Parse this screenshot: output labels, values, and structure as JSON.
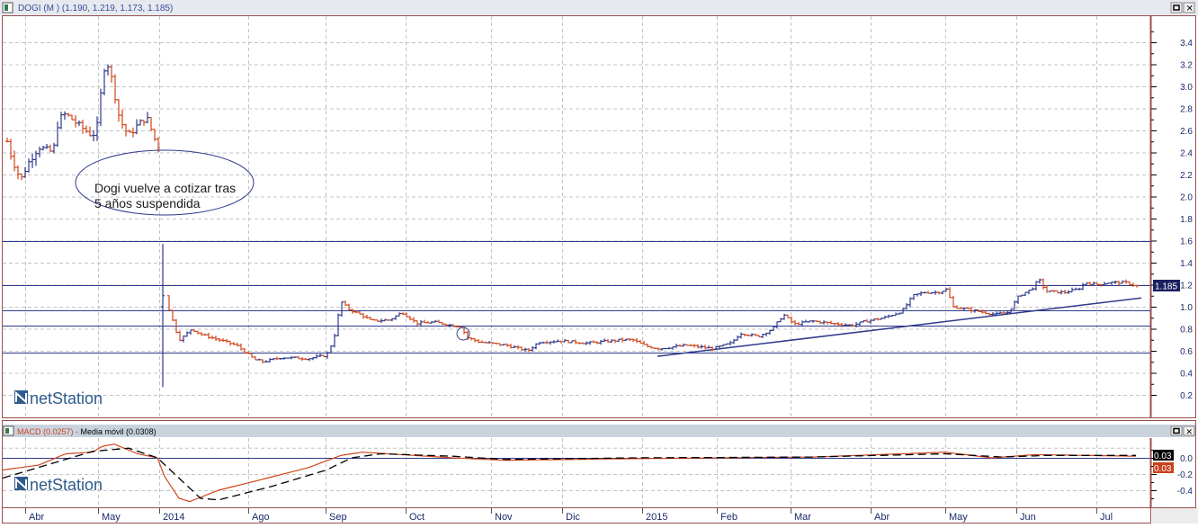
{
  "window": {
    "title": "DOGI (M ) (1.190, 1.219, 1.173, 1.185)",
    "minimize_icon": "restore-icon",
    "close_icon": "close-icon"
  },
  "annotation": {
    "line1": "Dogi vuelve a cotizar tras",
    "line2": "5 años suspendida"
  },
  "logo": "netStation",
  "price_tag": "1.185",
  "macd_panel": {
    "title_macd": "MACD (0.0257)",
    "title_sep": " - ",
    "title_signal": "Media móvil (0.0308)",
    "tag_signal": "0.03",
    "tag_macd": "0.03"
  },
  "colors": {
    "up": "#2e3a8c",
    "down": "#d0461c",
    "hline": "#2e3a8c",
    "frame": "#9b4f4f",
    "tag_bg": "#1a2060"
  },
  "chart_data": [
    {
      "type": "ohlc",
      "title": "DOGI (M )",
      "ylim": [
        0.1,
        3.5
      ],
      "yticks": [
        "0.2",
        "0.4",
        "0.6",
        "0.8",
        "1.0",
        "1.2",
        "1.4",
        "1.6",
        "1.8",
        "2.0",
        "2.2",
        "2.4",
        "2.6",
        "2.8",
        "3.0",
        "3.2",
        "3.4"
      ],
      "xticks": [
        "Abr",
        "May",
        "2014",
        "Ago",
        "Sep",
        "Oct",
        "Nov",
        "Dic",
        "2015",
        "Feb",
        "Mar",
        "Abr",
        "May",
        "Jun",
        "Jul"
      ],
      "x_range_bars": [
        0,
        320
      ],
      "gap_after_bar": 43.5,
      "spike_bar": {
        "x": 44.5,
        "low": 0.27,
        "high": 1.57,
        "close": 1.1
      },
      "close_path": [
        [
          1.25,
          2.5
        ],
        [
          2.5,
          2.35
        ],
        [
          5,
          2.15
        ],
        [
          7,
          2.3
        ],
        [
          10,
          2.45
        ],
        [
          14,
          2.4
        ],
        [
          15.5,
          2.7
        ],
        [
          17.5,
          2.75
        ],
        [
          21,
          2.65
        ],
        [
          25,
          2.55
        ],
        [
          27,
          2.7
        ],
        [
          27.5,
          3.15
        ],
        [
          29.5,
          3.2
        ],
        [
          31,
          2.95
        ],
        [
          32.5,
          2.7
        ],
        [
          35,
          2.55
        ],
        [
          37.5,
          2.65
        ],
        [
          40,
          2.72
        ],
        [
          42.5,
          2.5
        ],
        [
          43.5,
          2.45
        ],
        [
          45.5,
          1.02
        ],
        [
          46,
          1.0
        ],
        [
          49,
          0.7
        ],
        [
          50,
          0.72
        ],
        [
          52.5,
          0.8
        ],
        [
          55,
          0.75
        ],
        [
          60,
          0.7
        ],
        [
          65,
          0.65
        ],
        [
          70,
          0.52
        ],
        [
          72.5,
          0.5
        ],
        [
          77.5,
          0.54
        ],
        [
          85,
          0.53
        ],
        [
          90,
          0.56
        ],
        [
          92,
          0.7
        ],
        [
          94,
          1.05
        ],
        [
          96,
          0.98
        ],
        [
          100,
          0.92
        ],
        [
          102.5,
          0.87
        ],
        [
          107.5,
          0.88
        ],
        [
          111,
          0.95
        ],
        [
          115,
          0.85
        ],
        [
          120,
          0.86
        ],
        [
          125,
          0.83
        ],
        [
          127.5,
          0.82
        ],
        [
          129,
          0.72
        ],
        [
          132.5,
          0.68
        ],
        [
          140,
          0.65
        ],
        [
          146,
          0.6
        ],
        [
          149,
          0.68
        ],
        [
          155,
          0.69
        ],
        [
          162.5,
          0.67
        ],
        [
          172.5,
          0.7
        ],
        [
          175,
          0.7
        ],
        [
          179,
          0.64
        ],
        [
          182.5,
          0.62
        ],
        [
          190,
          0.65
        ],
        [
          197.5,
          0.62
        ],
        [
          202.5,
          0.67
        ],
        [
          205,
          0.76
        ],
        [
          210,
          0.73
        ],
        [
          214,
          0.8
        ],
        [
          217,
          0.93
        ],
        [
          220,
          0.84
        ],
        [
          225,
          0.87
        ],
        [
          230,
          0.85
        ],
        [
          236,
          0.83
        ],
        [
          240,
          0.87
        ],
        [
          245,
          0.9
        ],
        [
          250,
          0.96
        ],
        [
          253,
          1.1
        ],
        [
          256,
          1.13
        ],
        [
          260,
          1.13
        ],
        [
          262.5,
          1.16
        ],
        [
          264,
          1.0
        ],
        [
          267.5,
          0.98
        ],
        [
          272.5,
          0.95
        ],
        [
          276,
          0.93
        ],
        [
          279.5,
          0.95
        ],
        [
          282.5,
          1.1
        ],
        [
          286,
          1.16
        ],
        [
          288,
          1.25
        ],
        [
          290,
          1.14
        ],
        [
          295,
          1.13
        ],
        [
          299,
          1.16
        ],
        [
          301,
          1.22
        ],
        [
          304,
          1.2
        ],
        [
          307.5,
          1.22
        ],
        [
          312,
          1.22
        ],
        [
          315.5,
          1.185
        ]
      ],
      "horizontal_levels": [
        1.6,
        1.2,
        0.97,
        0.83,
        0.58
      ],
      "trendline": [
        [
          182,
          0.55
        ],
        [
          316.5,
          1.08
        ]
      ],
      "last_value": 1.185
    },
    {
      "type": "line",
      "title": "MACD",
      "ylim": [
        -0.6,
        0.25
      ],
      "yticks": [
        "0.0",
        "-0.2",
        "-0.4"
      ],
      "series": [
        {
          "name": "MACD (0.0257)",
          "style": "solid",
          "points": [
            [
              0,
              -0.15
            ],
            [
              10,
              -0.09
            ],
            [
              17.5,
              0.05
            ],
            [
              25,
              0.07
            ],
            [
              27.5,
              0.14
            ],
            [
              31,
              0.17
            ],
            [
              37.5,
              0.05
            ],
            [
              43,
              0.0
            ],
            [
              45,
              -0.23
            ],
            [
              49,
              -0.5
            ],
            [
              52,
              -0.54
            ],
            [
              60,
              -0.4
            ],
            [
              70,
              -0.29
            ],
            [
              85,
              -0.12
            ],
            [
              94,
              0.03
            ],
            [
              100,
              0.07
            ],
            [
              125,
              0.0
            ],
            [
              140,
              -0.03
            ],
            [
              175,
              -0.01
            ],
            [
              225,
              0.01
            ],
            [
              262,
              0.07
            ],
            [
              275,
              0.0
            ],
            [
              287,
              0.04
            ],
            [
              315,
              0.02
            ]
          ]
        },
        {
          "name": "Media móvil (0.0308)",
          "style": "dashed",
          "points": [
            [
              0,
              -0.25
            ],
            [
              25,
              0.08
            ],
            [
              35,
              0.12
            ],
            [
              43,
              0.0
            ],
            [
              49,
              -0.25
            ],
            [
              55,
              -0.5
            ],
            [
              60,
              -0.52
            ],
            [
              75,
              -0.35
            ],
            [
              90,
              -0.15
            ],
            [
              97,
              0.0
            ],
            [
              105,
              0.05
            ],
            [
              125,
              0.02
            ],
            [
              140,
              -0.02
            ],
            [
              175,
              0.0
            ],
            [
              225,
              0.01
            ],
            [
              262,
              0.05
            ],
            [
              278,
              0.01
            ],
            [
              290,
              0.03
            ],
            [
              315,
              0.03
            ]
          ]
        }
      ],
      "last_values": {
        "macd": 0.0257,
        "signal": 0.0308
      }
    }
  ]
}
